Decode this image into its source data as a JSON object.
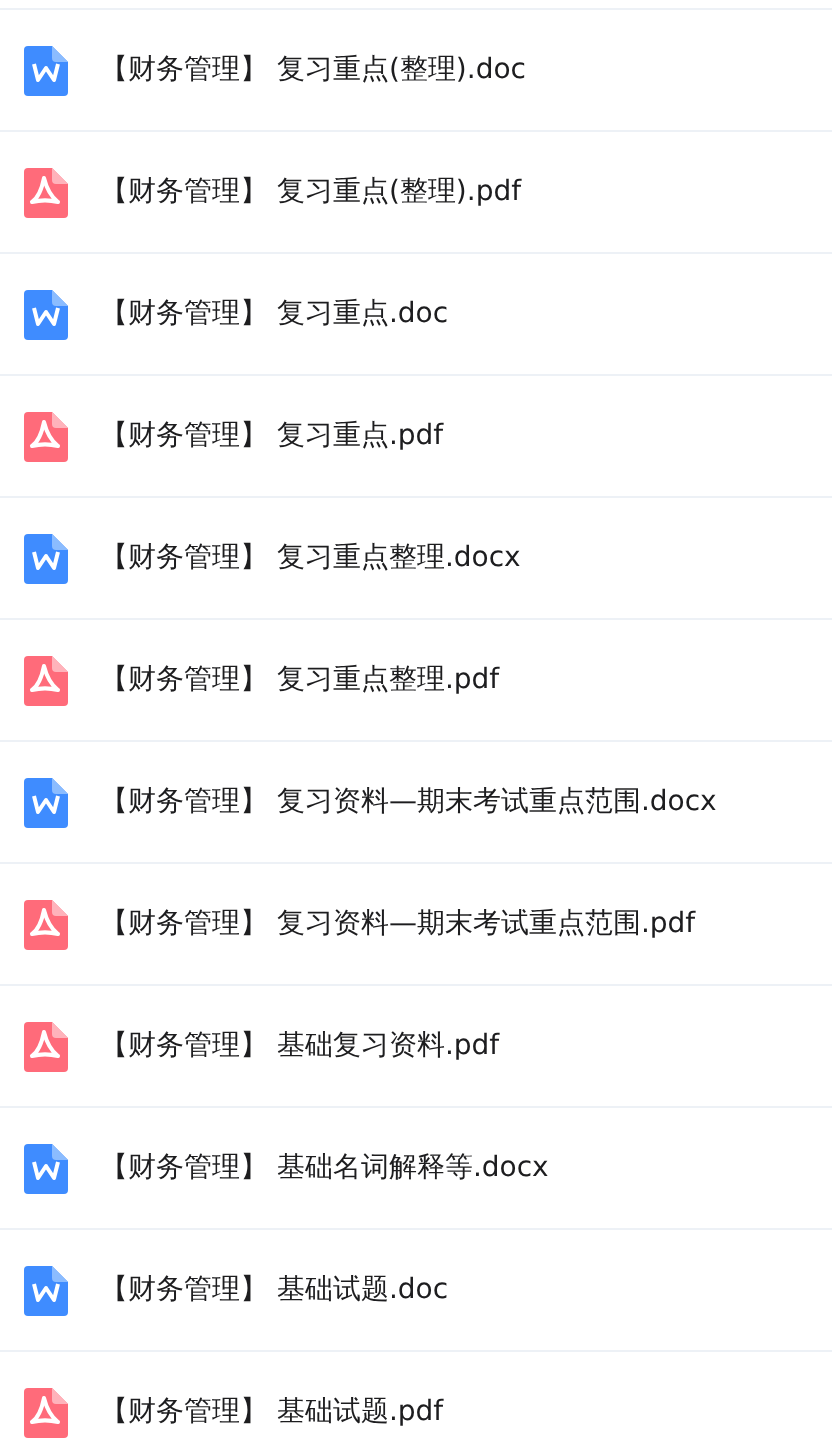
{
  "files": [
    {
      "kind": "word",
      "name": "【财务管理】 复习重点(整理).doc"
    },
    {
      "kind": "pdf",
      "name": "【财务管理】 复习重点(整理).pdf"
    },
    {
      "kind": "word",
      "name": "【财务管理】 复习重点.doc"
    },
    {
      "kind": "pdf",
      "name": "【财务管理】 复习重点.pdf"
    },
    {
      "kind": "word",
      "name": "【财务管理】 复习重点整理.docx"
    },
    {
      "kind": "pdf",
      "name": "【财务管理】 复习重点整理.pdf"
    },
    {
      "kind": "word",
      "name": "【财务管理】 复习资料—期末考试重点范围.docx"
    },
    {
      "kind": "pdf",
      "name": "【财务管理】 复习资料—期末考试重点范围.pdf"
    },
    {
      "kind": "pdf",
      "name": "【财务管理】 基础复习资料.pdf"
    },
    {
      "kind": "word",
      "name": "【财务管理】 基础名词解释等.docx"
    },
    {
      "kind": "word",
      "name": "【财务管理】 基础试题.doc"
    },
    {
      "kind": "pdf",
      "name": "【财务管理】 基础试题.pdf"
    }
  ]
}
